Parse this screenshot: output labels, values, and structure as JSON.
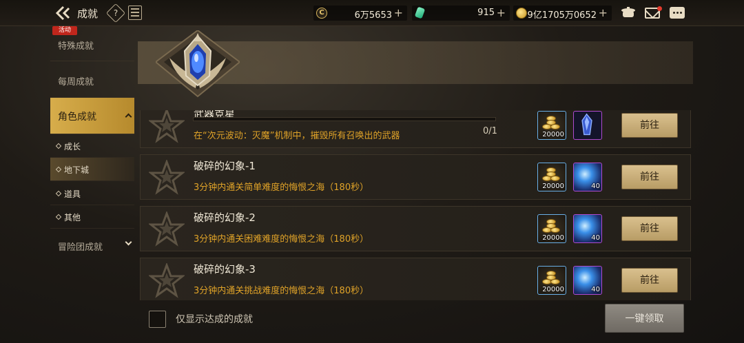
{
  "header": {
    "title": "成就",
    "help_label": "?",
    "currencies": [
      {
        "icon": "gold-coin-c-icon",
        "value": "6万5653"
      },
      {
        "icon": "green-gem-icon",
        "value": "915"
      },
      {
        "icon": "gold-coin-icon",
        "value": "9亿1705万0652"
      }
    ],
    "plus_label": "+"
  },
  "sidebar": {
    "special": {
      "label": "特殊成就",
      "badge": "活动"
    },
    "weekly": {
      "label": "每周成就"
    },
    "character": {
      "label": "角色成就"
    },
    "subs": [
      {
        "label": "成长"
      },
      {
        "label": "地下城",
        "selected": true
      },
      {
        "label": "道具"
      },
      {
        "label": "其他"
      }
    ],
    "adventure": {
      "label": "冒险团成就"
    }
  },
  "achievements": [
    {
      "name": "武器克星",
      "desc": "在“次元波动：灭魔”机制中，摧毁所有召唤出的武器",
      "progress": "0/1",
      "progress_fraction": 0,
      "reward1_qty": "20000",
      "reward2_qty": "",
      "go_label": "前往"
    },
    {
      "name": "破碎的幻象-1",
      "desc": "3分钟内通关简单难度的悔恨之海（180秒）",
      "reward1_qty": "20000",
      "reward2_qty": "40",
      "go_label": "前往"
    },
    {
      "name": "破碎的幻象-2",
      "desc": "3分钟内通关困难难度的悔恨之海（180秒）",
      "reward1_qty": "20000",
      "reward2_qty": "40",
      "go_label": "前往"
    },
    {
      "name": "破碎的幻象-3",
      "desc": "3分钟内通关挑战难度的悔恨之海（180秒）",
      "reward1_qty": "20000",
      "reward2_qty": "40",
      "go_label": "前往"
    }
  ],
  "footer": {
    "filter_label": "仅显示达成的成就",
    "claim_all_label": "一键领取"
  }
}
